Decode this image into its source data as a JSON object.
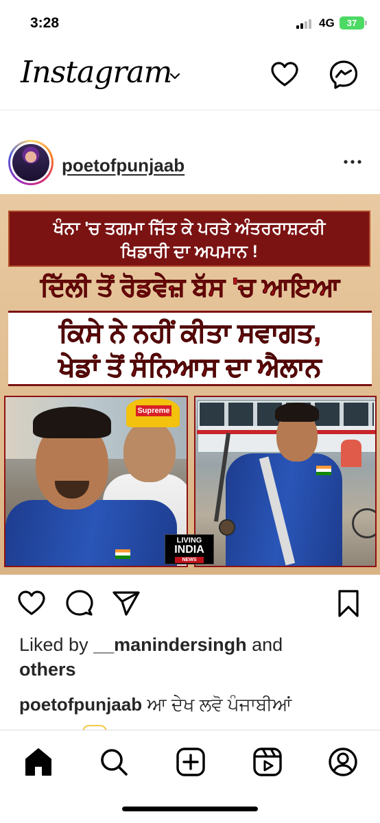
{
  "status_bar": {
    "time": "3:28",
    "network": "4G",
    "battery": "37"
  },
  "header": {
    "logo": "Instagram",
    "icons": [
      "chevron-down-icon",
      "heart-icon",
      "messenger-icon"
    ]
  },
  "post": {
    "username": "poetofpunjaab",
    "image": {
      "headline_1": "ਖੰਨਾ 'ਚ ਤਗਮਾ ਜਿੱਤ ਕੇ ਪਰਤੇ ਅੰਤਰਰਾਸ਼ਟਰੀ",
      "headline_2": "ਖਿਡਾਰੀ ਦਾ ਅਪਮਾਨ !",
      "headline_3": "ਦਿੱਲੀ ਤੋਂ ਰੋਡਵੇਜ਼ ਬੱਸ 'ਚ ਆਇਆ",
      "headline_4": "ਕਿਸੇ ਨੇ ਨਹੀਂ ਕੀਤਾ ਸਵਾਗਤ,",
      "headline_5": "ਖੇਡਾਂ ਤੋਂ ਸੰਨਿਆਸ ਦਾ ਐਲਾਨ",
      "cap_text": "Supreme",
      "watermark_line1": "LIVING",
      "watermark_line2": "INDIA",
      "watermark_line3": "NEWS"
    },
    "likes_prefix": "Liked by ",
    "likes_user": "__manindersingh",
    "likes_mid": " and",
    "likes_others": "others",
    "caption_user": "poetofpunjaab",
    "caption_text": " ਆ ਦੇਖ ਲਵੋ ਪੰਜਾਬੀਆਂ"
  },
  "colors": {
    "accent_red": "#c0121b",
    "banner_dark_red": "#7b1313",
    "battery_green": "#4cd964"
  }
}
